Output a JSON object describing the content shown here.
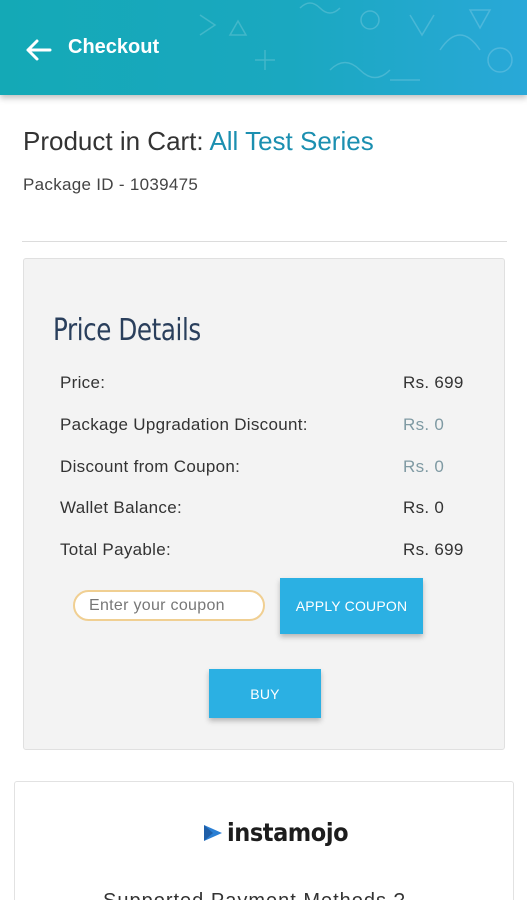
{
  "header": {
    "title": "Checkout",
    "back_icon": "arrow-left-icon",
    "background_gradient": [
      "#14a9b6",
      "#29a8d8"
    ]
  },
  "product": {
    "prefix": "Product in Cart:",
    "name": "All Test Series",
    "package_id": "Package ID - 1039475"
  },
  "price_details": {
    "title": "Price Details",
    "rows": [
      {
        "label": "Price:",
        "value": "Rs. 699"
      },
      {
        "label": "Package Upgradation Discount:",
        "value": "Rs. 0"
      },
      {
        "label": "Discount from Coupon:",
        "value": "Rs. 0"
      },
      {
        "label": "Wallet Balance:",
        "value": "Rs. 0"
      },
      {
        "label": "Total Payable:",
        "value": "Rs. 699"
      }
    ],
    "coupon_placeholder": "Enter your coupon",
    "coupon_value": "",
    "apply_label": "APPLY COUPON",
    "buy_label": "BUY"
  },
  "payment": {
    "brand": "instamojo",
    "supported_text": "Supported Payment Methods ?"
  },
  "colors": {
    "accent": "#2bb0e3",
    "product_name": "#1b8fb0",
    "coupon_border": "#f0cf92",
    "muted_value": "#7f9aa3"
  }
}
